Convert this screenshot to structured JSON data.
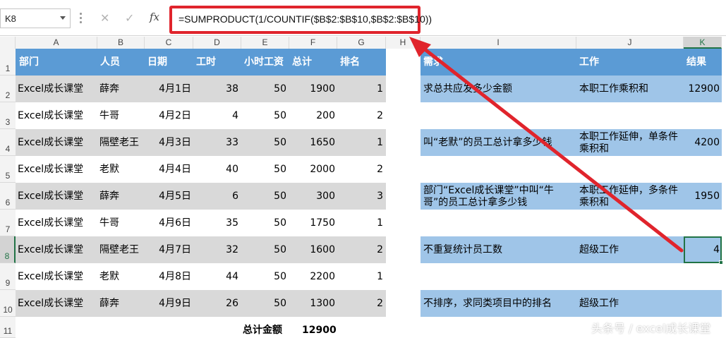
{
  "formula_bar": {
    "name_box": "K8",
    "cancel_glyph": "✕",
    "enter_glyph": "✓",
    "fx_label": "fx",
    "formula": "=SUMPRODUCT(1/COUNTIF($B$2:$B$10,$B$2:$B$10))"
  },
  "columns": [
    "A",
    "B",
    "C",
    "D",
    "E",
    "F",
    "G",
    "H",
    "I",
    "J",
    "K"
  ],
  "rows": [
    "1",
    "2",
    "3",
    "4",
    "5",
    "6",
    "7",
    "8",
    "9",
    "10",
    "11"
  ],
  "active_cell": {
    "column": "K",
    "row": "8"
  },
  "left_table": {
    "headers": [
      "部门",
      "人员",
      "日期",
      "工时",
      "小时工资",
      "总计",
      "排名"
    ],
    "rows": [
      [
        "Excel成长课堂",
        "薛奔",
        "4月1日",
        "38",
        "50",
        "1900",
        "1"
      ],
      [
        "Excel成长课堂",
        "牛哥",
        "4月2日",
        "4",
        "50",
        "200",
        "2"
      ],
      [
        "Excel成长课堂",
        "隔壁老王",
        "4月3日",
        "33",
        "50",
        "1650",
        "1"
      ],
      [
        "Excel成长课堂",
        "老默",
        "4月4日",
        "40",
        "50",
        "2000",
        "2"
      ],
      [
        "Excel成长课堂",
        "薛奔",
        "4月5日",
        "6",
        "50",
        "300",
        "3"
      ],
      [
        "Excel成长课堂",
        "牛哥",
        "4月6日",
        "35",
        "50",
        "1750",
        "1"
      ],
      [
        "Excel成长课堂",
        "隔壁老王",
        "4月7日",
        "32",
        "50",
        "1600",
        "2"
      ],
      [
        "Excel成长课堂",
        "老默",
        "4月8日",
        "44",
        "50",
        "2200",
        "1"
      ],
      [
        "Excel成长课堂",
        "薛奔",
        "4月9日",
        "26",
        "50",
        "1300",
        "2"
      ]
    ],
    "total_label": "总计金额",
    "total_value": "12900"
  },
  "right_table": {
    "headers": [
      "需求",
      "工作",
      "结果"
    ],
    "rows": [
      {
        "need": "求总共应发多少金额",
        "work": "本职工作乘积和",
        "result": "12900"
      },
      {
        "need": "叫“老默”的员工总计拿多少钱",
        "work": "本职工作延伸，单条件乘积和",
        "result": "4200"
      },
      {
        "need": "部门“Excel成长课堂”中叫“牛哥”的员工总计拿多少钱",
        "work": "本职工作延伸，多条件乘积和",
        "result": "1950"
      },
      {
        "need": "不重复统计员工数",
        "work": "超级工作",
        "result": "4"
      },
      {
        "need": "不排序，求同类项目中的排名",
        "work": "超级工作",
        "result": ""
      }
    ]
  },
  "watermark": "头条号 / excel成长课堂",
  "colors": {
    "header_blue": "#5b9bd5",
    "light_blue": "#9fc5e8",
    "band_gray": "#d9d9d9",
    "arrow_red": "#e0242c",
    "selection_green": "#217346"
  }
}
